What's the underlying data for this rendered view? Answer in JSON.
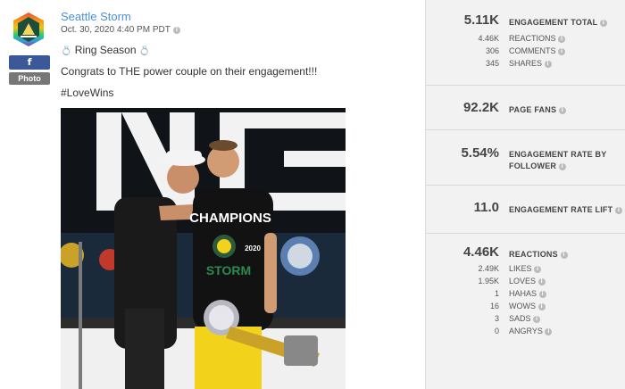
{
  "post": {
    "page_name": "Seattle Storm",
    "date": "Oct. 30, 2020 4:40 PM PDT",
    "network_badge": "f",
    "type_badge": "Photo",
    "line1_emoji_left": "💍",
    "line1_text": " Ring Season ",
    "line1_emoji_right": "💍",
    "line2": "Congrats to THE power couple on their engagement!!!",
    "line3": "#LoveWins",
    "photo_texts": {
      "shirt_top": "CHAMPIONS",
      "shirt_year": "2020",
      "shirt_team": "STORM"
    }
  },
  "metrics": {
    "engagement_total": {
      "value": "5.11K",
      "label": "ENGAGEMENT TOTAL"
    },
    "engagement_breakdown": [
      {
        "value": "4.46K",
        "label": "REACTIONS"
      },
      {
        "value": "306",
        "label": "COMMENTS"
      },
      {
        "value": "345",
        "label": "SHARES"
      }
    ],
    "page_fans": {
      "value": "92.2K",
      "label": "PAGE FANS"
    },
    "engagement_rate": {
      "value": "5.54%",
      "label_line1": "ENGAGEMENT RATE BY",
      "label_line2": "FOLLOWER"
    },
    "engagement_lift": {
      "value": "11.0",
      "label": "ENGAGEMENT RATE LIFT"
    },
    "reactions": {
      "value": "4.46K",
      "label": "REACTIONS"
    },
    "reactions_breakdown": [
      {
        "value": "2.49K",
        "label": "LIKES"
      },
      {
        "value": "1.95K",
        "label": "LOVES"
      },
      {
        "value": "1",
        "label": "HAHAS"
      },
      {
        "value": "16",
        "label": "WOWS"
      },
      {
        "value": "3",
        "label": "SADS"
      },
      {
        "value": "0",
        "label": "ANGRYS"
      }
    ]
  },
  "colors": {
    "link": "#4a90d9",
    "facebook": "#3b5998",
    "panel_bg": "#f2f2f2"
  }
}
